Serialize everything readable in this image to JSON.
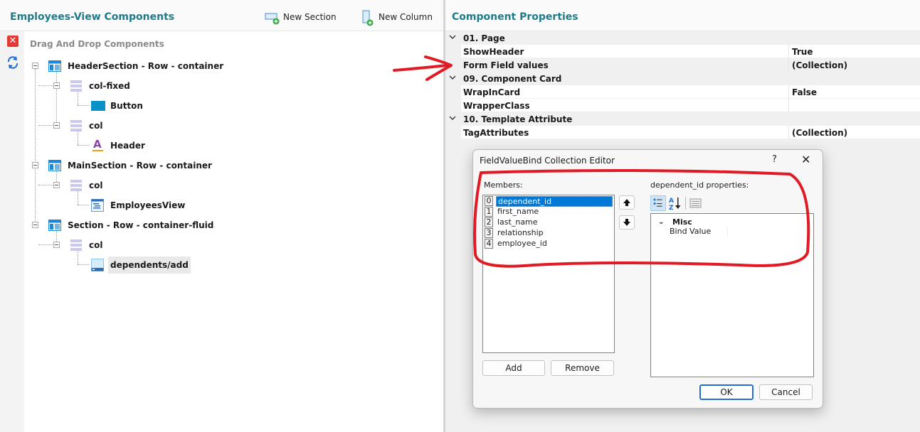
{
  "left": {
    "title": "Employees-View Components",
    "new_section_label": "New Section",
    "new_column_label": "New Column",
    "drag_label": "Drag And Drop Components",
    "tree": {
      "header_section": "HeaderSection - Row - container",
      "col_fixed": "col-fixed",
      "button": "Button",
      "col_1": "col",
      "header": "Header",
      "main_section": "MainSection - Row - container",
      "col_2": "col",
      "employees_view": "EmployeesView",
      "section": "Section - Row - container-fluid",
      "col_3": "col",
      "dependents_add": "dependents/add"
    }
  },
  "right": {
    "title": "Component Properties",
    "rows": [
      {
        "kind": "cat",
        "name": "01. Page"
      },
      {
        "kind": "prop",
        "name": "ShowHeader",
        "value": "True"
      },
      {
        "kind": "prop",
        "name": "Form Field values",
        "value": "(Collection)"
      },
      {
        "kind": "cat",
        "name": "09. Component Card"
      },
      {
        "kind": "prop",
        "name": "WrapInCard",
        "value": "False"
      },
      {
        "kind": "prop",
        "name": "WrapperClass",
        "value": ""
      },
      {
        "kind": "cat",
        "name": "10. Template Attribute"
      },
      {
        "kind": "prop",
        "name": "TagAttributes",
        "value": "(Collection)"
      }
    ]
  },
  "dialog": {
    "title": "FieldValueBind Collection Editor",
    "help": "?",
    "close": "✕",
    "members_label": "Members:",
    "members": [
      {
        "index": "0",
        "name": "dependent_id",
        "selected": true
      },
      {
        "index": "1",
        "name": "first_name"
      },
      {
        "index": "2",
        "name": "last_name"
      },
      {
        "index": "3",
        "name": "relationship"
      },
      {
        "index": "4",
        "name": "employee_id"
      }
    ],
    "props_label": "dependent_id properties:",
    "category": "Misc",
    "property_name": "Bind Value",
    "property_value": "",
    "add_label": "Add",
    "remove_label": "Remove",
    "ok_label": "OK",
    "cancel_label": "Cancel"
  },
  "colors": {
    "title_teal": "#1e7b8a",
    "selection_blue": "#0078d7",
    "annotation_red": "#e01b24"
  },
  "icons": [
    "plus-icon",
    "close-icon",
    "refresh-icon",
    "row-layout-icon",
    "column-layout-icon",
    "button-icon",
    "text-header-icon",
    "view-icon",
    "form-icon",
    "arrow-up-icon",
    "arrow-down-icon",
    "categorized-icon",
    "sort-alpha-icon",
    "property-pages-icon",
    "chevron-down-icon"
  ]
}
